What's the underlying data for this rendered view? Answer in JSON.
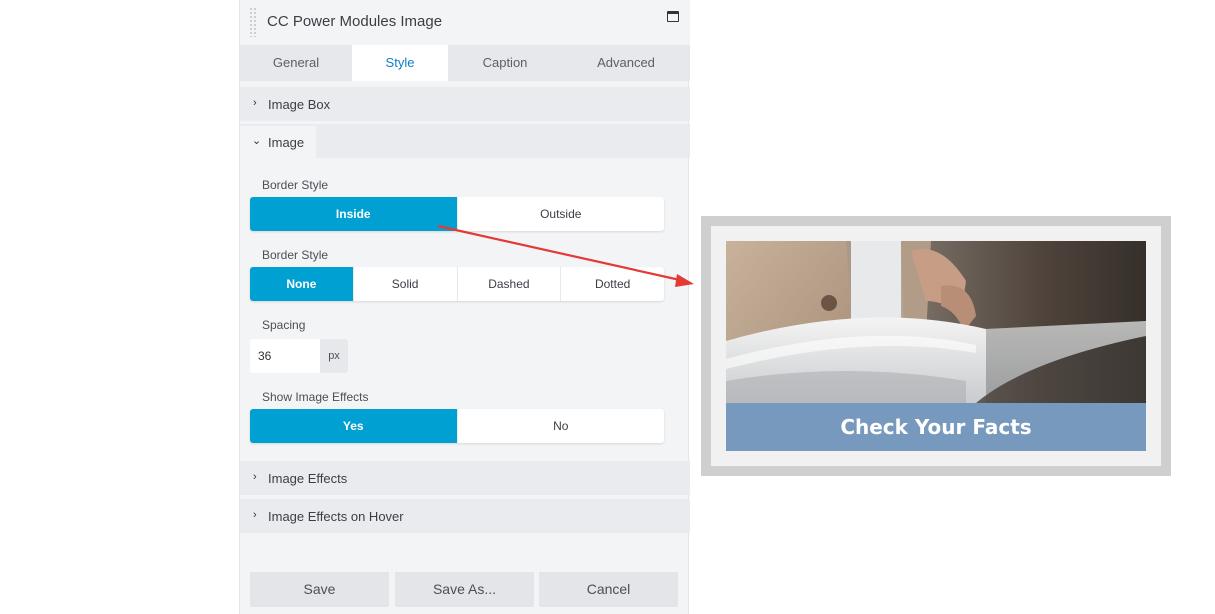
{
  "panel": {
    "title": "CC Power Modules Image",
    "window_icon": "window-restore-icon"
  },
  "tabs": [
    {
      "label": "General",
      "active": false
    },
    {
      "label": "Style",
      "active": true
    },
    {
      "label": "Caption",
      "active": false
    },
    {
      "label": "Advanced",
      "active": false
    }
  ],
  "sections": {
    "image_box": "Image Box",
    "image": "Image",
    "image_effects": "Image Effects",
    "image_effects_hover": "Image Effects on Hover"
  },
  "fields": {
    "border_position": {
      "label": "Border Style",
      "options": [
        "Inside",
        "Outside"
      ],
      "selected": "Inside"
    },
    "border_style": {
      "label": "Border Style",
      "options": [
        "None",
        "Solid",
        "Dashed",
        "Dotted"
      ],
      "selected": "None"
    },
    "spacing": {
      "label": "Spacing",
      "value": "36",
      "unit": "px"
    },
    "show_image_effects": {
      "label": "Show Image Effects",
      "options": [
        "Yes",
        "No"
      ],
      "selected": "Yes"
    }
  },
  "footer": {
    "save": "Save",
    "save_as": "Save As...",
    "cancel": "Cancel"
  },
  "preview": {
    "caption": "Check Your Facts",
    "caption_color": "#7699bd",
    "frame_color": "#cfcfcf"
  },
  "colors": {
    "accent": "#00a0d2",
    "tab_active_text": "#0e7fbf",
    "annotation_arrow": "#e53935"
  }
}
